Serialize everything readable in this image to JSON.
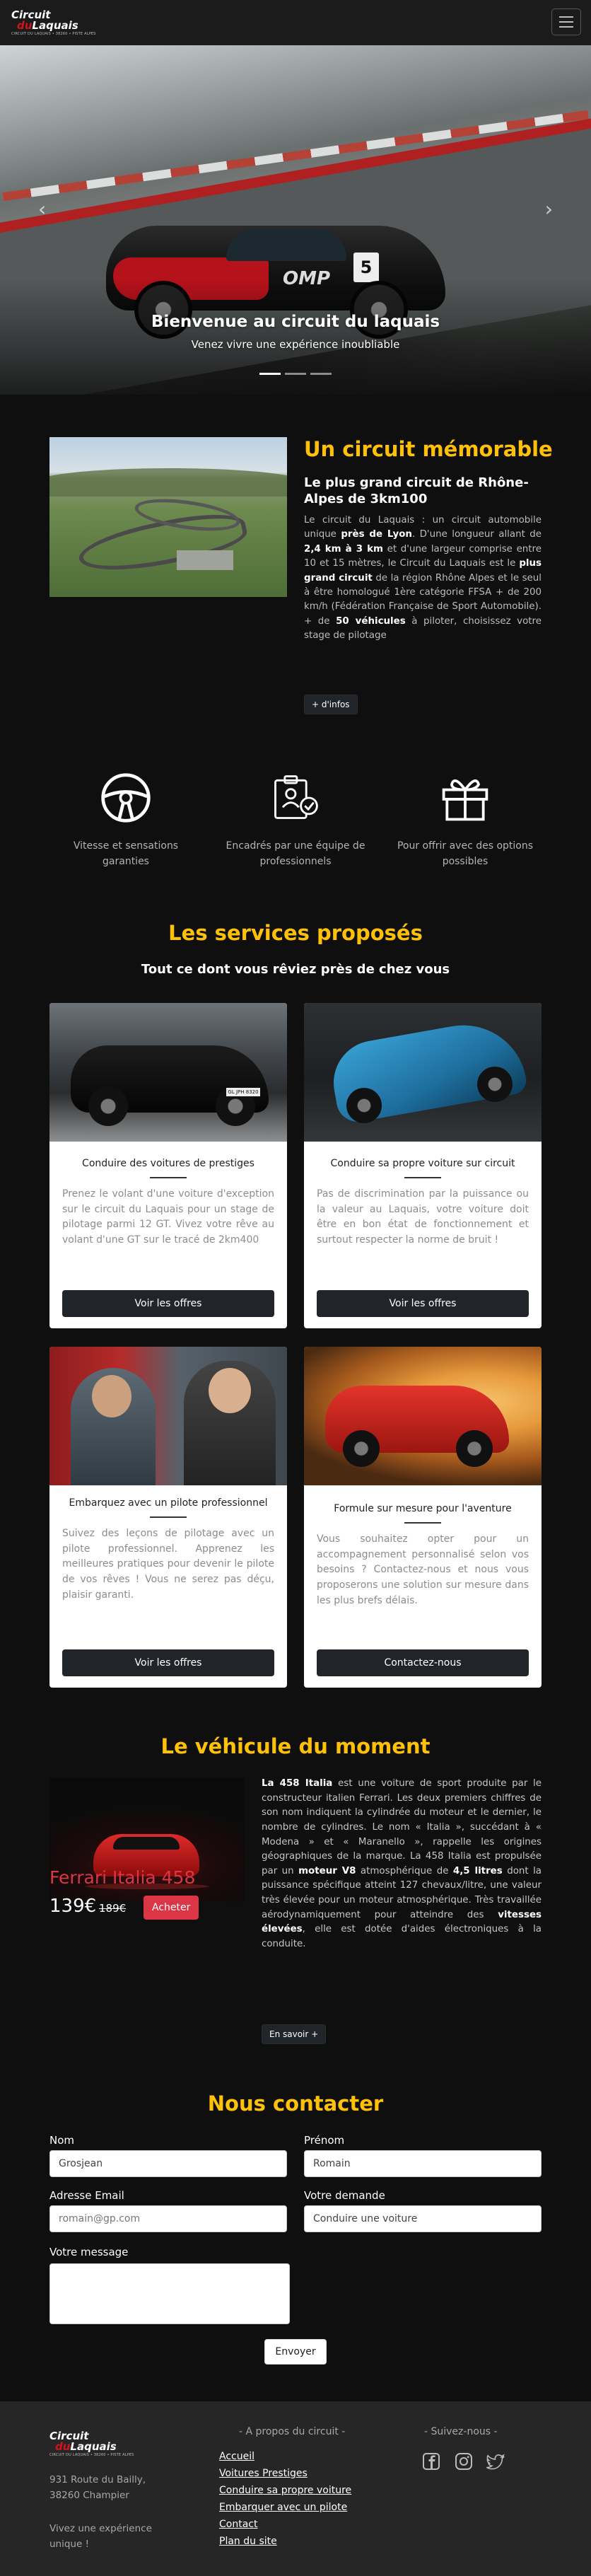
{
  "nav": {
    "logo_line1": "Circuit",
    "logo_line2_prefix": "du",
    "logo_line2": "Laquais",
    "logo_tagline": "CIRCUIT DU LAQUAIS • 38260 • PISTE ALPES",
    "menu_icon": "hamburger-icon"
  },
  "hero": {
    "title": "Bienvenue au circuit du laquais",
    "subtitle": "Venez vivre une expérience inoubliable",
    "car_number": "5",
    "car_sponsor": "OMP",
    "prev_icon": "chevron-left-icon",
    "next_icon": "chevron-right-icon",
    "slides": 3,
    "active_slide": 1
  },
  "about": {
    "title": "Un circuit mémorable",
    "subtitle": "Le plus grand circuit de Rhône-Alpes de 3km100",
    "p1": "Le circuit du Laquais : un circuit automobile unique ",
    "p1b": "près de Lyon",
    "p2": ". D'une longueur allant de ",
    "p2b": "2,4 km à 3 km",
    "p3": " et d'une largeur comprise entre 10 et 15 mètres, le Circuit du Laquais est le ",
    "p3b": "plus grand circuit",
    "p4": " de la région Rhône Alpes et le seul à être homologué 1ère catégorie FFSA + de 200 km/h (Fédération Française de Sport Automobile). + de ",
    "p4b": "50 véhicules",
    "p5": " à piloter, choisissez votre stage de pilotage",
    "button": "+ d'infos"
  },
  "features": [
    {
      "icon": "steering-wheel-icon",
      "text": "Vitesse et sensations garanties"
    },
    {
      "icon": "instructor-badge-icon",
      "text": "Encadrés par une équipe de professionnels"
    },
    {
      "icon": "gift-icon",
      "text": "Pour offrir avec des options possibles"
    }
  ],
  "services": {
    "title": "Les services proposés",
    "subtitle": "Tout ce dont vous rêviez près de chez vous",
    "cards": [
      {
        "title": "Conduire des voitures de prestiges",
        "text": "Prenez le volant d'une voiture d'exception sur le circuit du Laquais pour un stage de pilotage parmi 12 GT. Vivez votre rêve au volant d'une GT sur le tracé de 2km400",
        "button": "Voir les offres",
        "plate": "GL JPH 8320"
      },
      {
        "title": "Conduire sa propre voiture sur circuit",
        "text": "Pas de discrimination par la puissance ou la valeur au Laquais, votre voiture doit être en bon état de fonctionnement et surtout respecter la norme de bruit !",
        "button": "Voir les offres"
      },
      {
        "title": "Embarquez avec un pilote professionnel",
        "text": "Suivez des leçons de pilotage avec un pilote professionnel. Apprenez les meilleures pratiques pour devenir le pilote de vos rêves ! Vous ne serez pas déçu, plaisir garanti.",
        "button": "Voir les offres"
      },
      {
        "title": "Formule sur mesure pour l'aventure",
        "text": "Vous souhaitez opter pour un accompagnement personnalisé selon vos besoins ? Contactez-nous et nous vous proposerons une solution sur mesure dans les plus brefs délais.",
        "button": "Contactez-nous"
      }
    ]
  },
  "vehicle": {
    "title": "Le véhicule du moment",
    "name": "Ferrari Italia 458",
    "price": "139€",
    "old_price": "189€",
    "buy_button": "Acheter",
    "t1b": "La 458 Italia",
    "t1": " est une voiture de sport produite par le constructeur italien Ferrari. Les deux premiers chiffres de son nom indiquent la cylindrée du moteur et le dernier, le nombre de cylindres. Le nom « Italia », succédant à « Modena » et « Maranello », rappelle les origines géographiques de la marque. La 458 Italia est propulsée par un ",
    "t2b": "moteur V8",
    "t2": " atmosphérique de ",
    "t3b": "4,5 litres",
    "t3": " dont la puissance spécifique atteint 127 chevaux/litre, une valeur très élevée pour un moteur atmosphérique. Très travaillée aérodynamiquement pour atteindre des ",
    "t4b": "vitesses élevées",
    "t4": ", elle est dotée d'aides électroniques à la conduite.",
    "more_button": "En savoir +"
  },
  "contact": {
    "title": "Nous contacter",
    "nom_label": "Nom",
    "nom_value": "Grosjean",
    "prenom_label": "Prénom",
    "prenom_value": "Romain",
    "email_label": "Adresse Email",
    "email_placeholder": "romain@gp.com",
    "demande_label": "Votre demande",
    "demande_value": "Conduire une voiture",
    "message_label": "Votre message",
    "send_button": "Envoyer"
  },
  "footer": {
    "address": "931 Route du Bailly, 38260 Champier",
    "slogan": "Vivez une expérience unique !",
    "about_heading": "- A propos du circuit -",
    "links": [
      "Accueil",
      "Voitures Prestiges",
      "Conduire sa propre voiture",
      "Embarquer avec un pilote",
      "Contact",
      "Plan du site"
    ],
    "social_heading": "- Suivez-nous -",
    "social_icons": [
      "facebook-icon",
      "instagram-icon",
      "twitter-icon"
    ]
  }
}
